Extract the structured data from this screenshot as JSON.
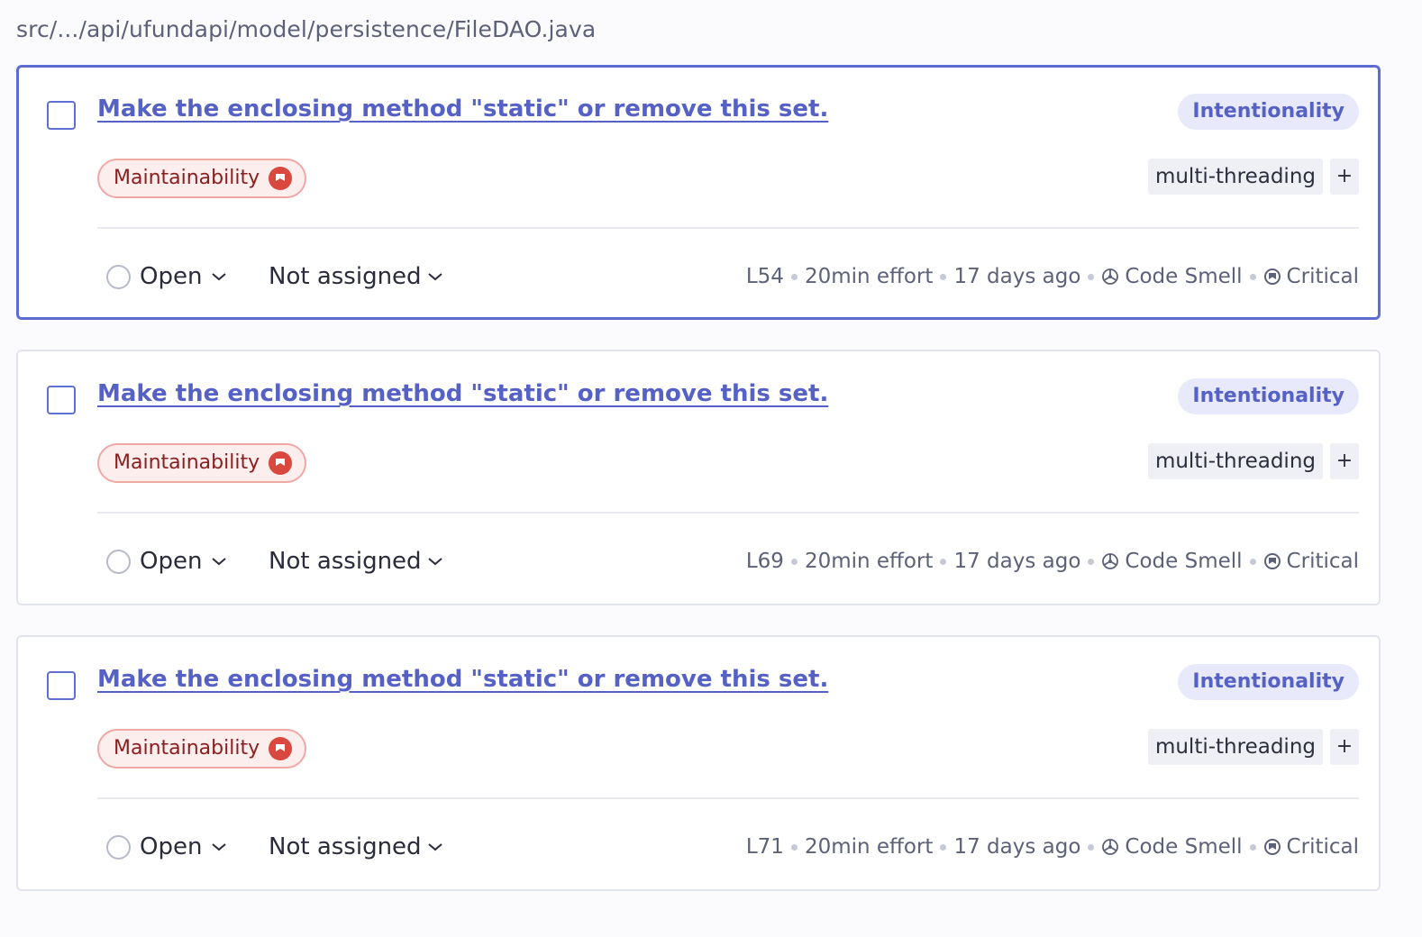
{
  "file_path": "src/.../api/ufundapi/model/persistence/FileDAO.java",
  "colors": {
    "accent": "#5561c4",
    "selected_border": "#5d6cd0",
    "impact_bg": "#fdeeee",
    "impact_icon": "#d9473f"
  },
  "issues": [
    {
      "title": "Make the enclosing method \"static\" or remove this set.",
      "attribute": "Intentionality",
      "impact": "Maintainability",
      "impact_icon": "severity-high-icon",
      "tags": [
        "multi-threading"
      ],
      "tag_add": "+",
      "status": "Open",
      "assignee": "Not assigned",
      "line": "L54",
      "effort": "20min effort",
      "age": "17 days ago",
      "type": "Code Smell",
      "severity": "Critical",
      "selected": true
    },
    {
      "title": "Make the enclosing method \"static\" or remove this set.",
      "attribute": "Intentionality",
      "impact": "Maintainability",
      "impact_icon": "severity-high-icon",
      "tags": [
        "multi-threading"
      ],
      "tag_add": "+",
      "status": "Open",
      "assignee": "Not assigned",
      "line": "L69",
      "effort": "20min effort",
      "age": "17 days ago",
      "type": "Code Smell",
      "severity": "Critical",
      "selected": false
    },
    {
      "title": "Make the enclosing method \"static\" or remove this set.",
      "attribute": "Intentionality",
      "impact": "Maintainability",
      "impact_icon": "severity-high-icon",
      "tags": [
        "multi-threading"
      ],
      "tag_add": "+",
      "status": "Open",
      "assignee": "Not assigned",
      "line": "L71",
      "effort": "20min effort",
      "age": "17 days ago",
      "type": "Code Smell",
      "severity": "Critical",
      "selected": false
    }
  ]
}
